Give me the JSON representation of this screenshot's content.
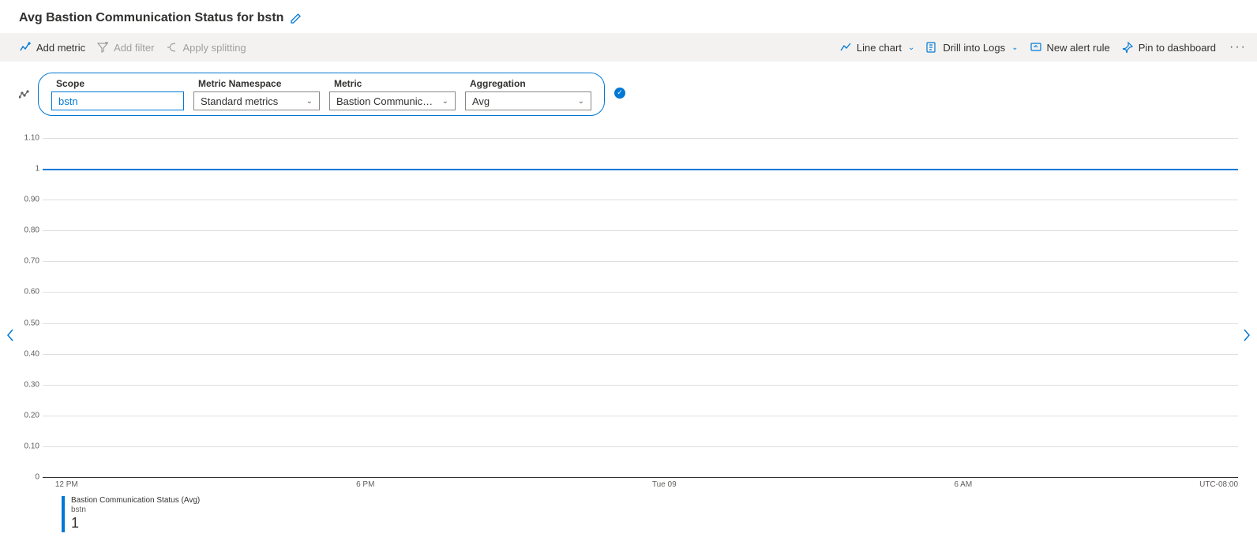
{
  "title": "Avg Bastion Communication Status for bstn",
  "toolbar": {
    "add_metric": "Add metric",
    "add_filter": "Add filter",
    "apply_splitting": "Apply splitting",
    "chart_type": "Line chart",
    "drill_logs": "Drill into Logs",
    "new_alert": "New alert rule",
    "pin_dashboard": "Pin to dashboard"
  },
  "selector": {
    "scope_label": "Scope",
    "scope_value": "bstn",
    "ns_label": "Metric Namespace",
    "ns_value": "Standard metrics",
    "metric_label": "Metric",
    "metric_value": "Bastion Communicatio...",
    "agg_label": "Aggregation",
    "agg_value": "Avg"
  },
  "chart_data": {
    "type": "line",
    "ylim": [
      0,
      1.1
    ],
    "y_ticks": [
      "1.10",
      "1",
      "0.90",
      "0.80",
      "0.70",
      "0.60",
      "0.50",
      "0.40",
      "0.30",
      "0.20",
      "0.10",
      "0"
    ],
    "x_ticks": [
      {
        "pos": 0.02,
        "label": "12 PM"
      },
      {
        "pos": 0.27,
        "label": "6 PM"
      },
      {
        "pos": 0.52,
        "label": "Tue 09"
      },
      {
        "pos": 0.77,
        "label": "6 AM"
      }
    ],
    "timezone": "UTC-08:00",
    "series": [
      {
        "name": "Bastion Communication Status (Avg)",
        "resource": "bstn",
        "value_const": 1
      }
    ]
  },
  "legend": {
    "name": "Bastion Communication Status (Avg)",
    "resource": "bstn",
    "value": "1"
  }
}
